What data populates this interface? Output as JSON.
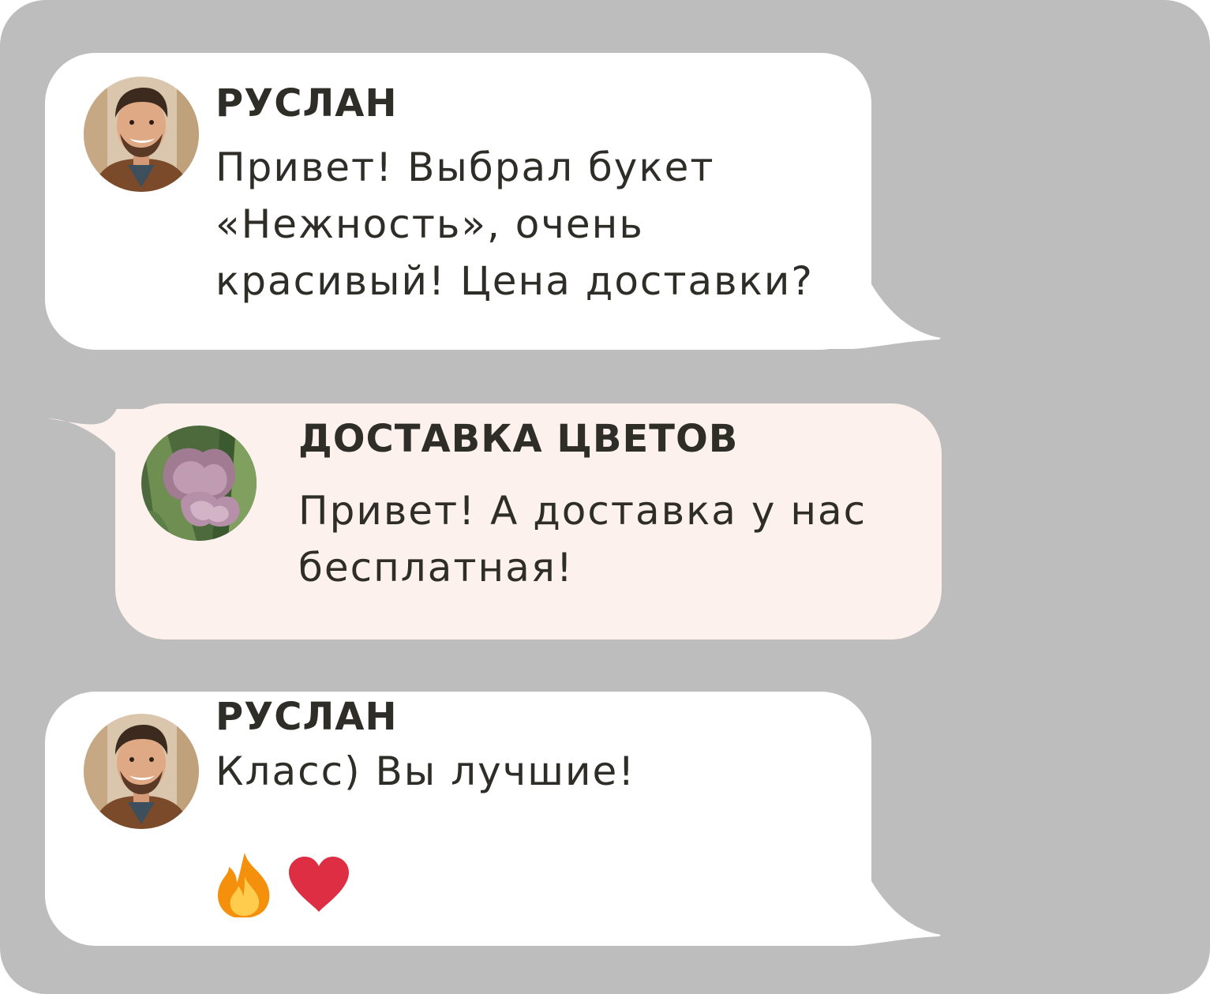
{
  "messages": [
    {
      "sender": "РУСЛАН",
      "text": "Привет! Выбрал букет\n«Нежность», очень\nкрасивый! Цена доставки?",
      "avatar": "man-portrait-avatar"
    },
    {
      "sender": "ДОСТАВКА ЦВЕТОВ",
      "text": "Привет! А доставка у нас\nбесплатная!",
      "avatar": "tulip-flowers-avatar"
    },
    {
      "sender": "РУСЛАН",
      "text": "Класс) Вы лучшие!",
      "avatar": "man-portrait-avatar",
      "emojis": [
        "fire-emoji",
        "heart-emoji"
      ]
    }
  ],
  "colors": {
    "background": "#bdbdbd",
    "incoming_bubble": "#ffffff",
    "reply_bubble": "#fdf1ee",
    "text": "#2e2d27",
    "heart": "#dd2e44",
    "fire": "#f4900c"
  }
}
